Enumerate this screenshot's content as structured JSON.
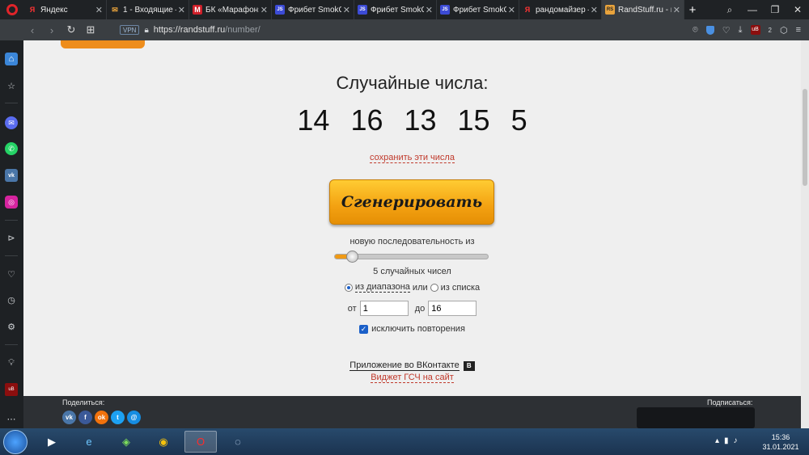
{
  "browser": {
    "tabs": [
      {
        "label": "Яндекс",
        "fav": "Я",
        "fav_color": "#f33"
      },
      {
        "label": "1 - Входящие —",
        "fav": "✉",
        "fav_color": "#e8a33c"
      },
      {
        "label": "БК «Марафон»",
        "fav": "M",
        "fav_color": "#d0202a"
      },
      {
        "label": "Фрибет SmokC",
        "fav": "JS",
        "fav_color": "#3c4bd6"
      },
      {
        "label": "Фрибет SmokC",
        "fav": "JS",
        "fav_color": "#3c4bd6"
      },
      {
        "label": "Фрибет SmokC",
        "fav": "JS",
        "fav_color": "#3c4bd6"
      },
      {
        "label": "рандомайзер –",
        "fav": "Я",
        "fav_color": "#f33"
      },
      {
        "label": "RandStuff.ru - г",
        "fav": "RS",
        "fav_color": "#e8a33c"
      }
    ],
    "vpn_label": "VPN",
    "url_domain": "https://randstuff.ru",
    "url_path": "/number/",
    "ublock_count": "2"
  },
  "page": {
    "headline": "Случайные числа:",
    "numbers": [
      "14",
      "16",
      "13",
      "15",
      "5"
    ],
    "save_link": "сохранить эти числа",
    "generate_label": "Сгенерировать",
    "sequence_label": "новую последовательность из",
    "slider_fraction": 0.08,
    "count_label": "5 случайных чисел",
    "range_option": "из диапазона",
    "or_text": "или",
    "list_option": "из списка",
    "from_label": "от",
    "from_value": "1",
    "to_label": "до",
    "to_value": "16",
    "no_repeat_label": "исключить повторения",
    "vk_app_link": "Приложение во ВКонтакте",
    "widget_link": "Виджет ГСЧ на сайт"
  },
  "footer": {
    "share_label": "Поделиться:",
    "subscribe_label": "Подписаться:"
  },
  "taskbar": {
    "time": "15:36",
    "date": "31.01.2021"
  },
  "colors": {
    "accent_orange": "#f3a111",
    "link_red": "#c0392b",
    "page_bg": "#efefef"
  }
}
